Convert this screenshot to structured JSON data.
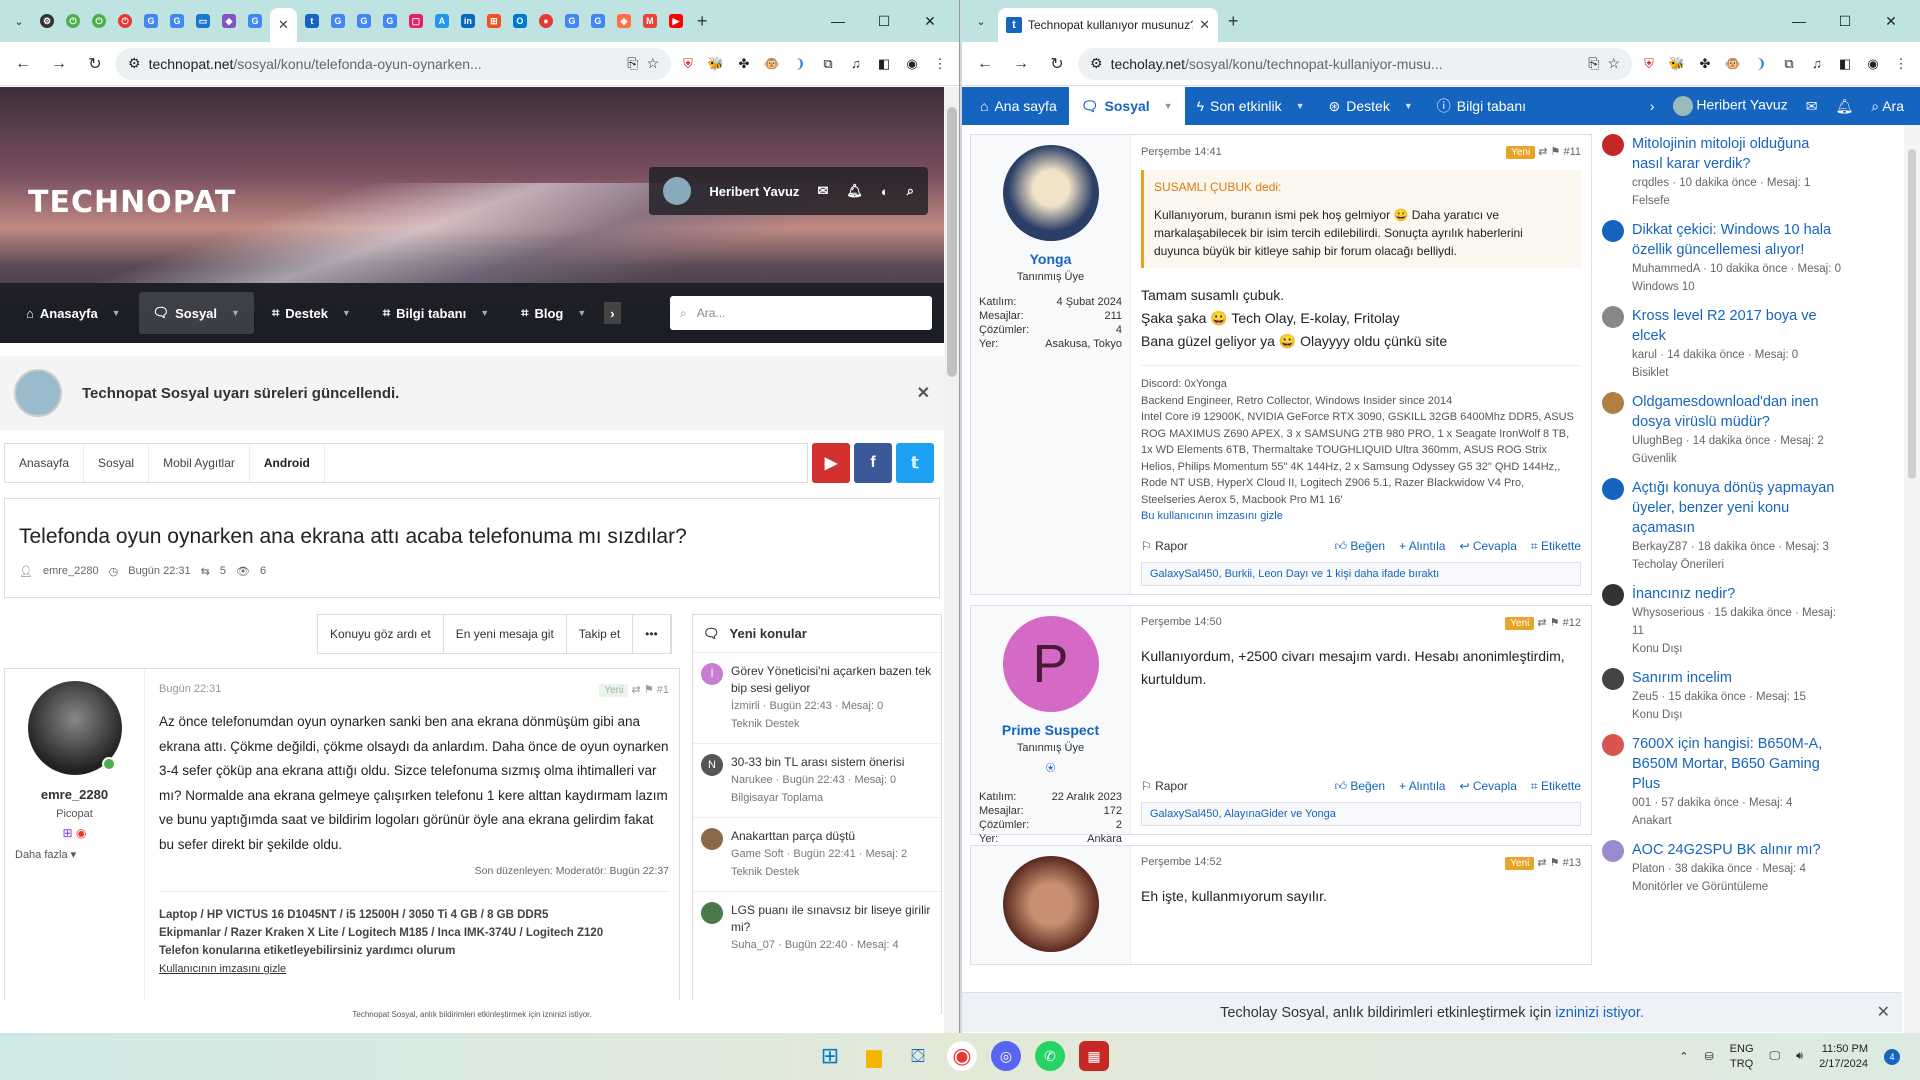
{
  "left_window": {
    "tabs_favicons": [
      "settings",
      "google",
      "power",
      "power",
      "opera",
      "google",
      "google",
      "blue",
      "image",
      "google"
    ],
    "active_tab_label": "",
    "url_host": "technopat.net",
    "url_path": "/sosyal/konu/telefonda-oyun-oynarken...",
    "page": {
      "logo": "TECHNOPAT",
      "user_name": "Heribert Yavuz",
      "nav_items": [
        "Anasayfa",
        "Sosyal",
        "Destek",
        "Bilgi tabanı",
        "Blog"
      ],
      "search_placeholder": "Ara...",
      "notice_text": "Technopat Sosyal uyarı süreleri güncellendi.",
      "breadcrumbs": [
        "Anasayfa",
        "Sosyal",
        "Mobil Aygıtlar",
        "Android"
      ],
      "thread_title": "Telefonda oyun oynarken ana ekrana attı acaba telefonuma mı sızdılar?",
      "thread_author": "emre_2280",
      "thread_date": "Bugün 22:31",
      "thread_replies": "5",
      "thread_views": "6",
      "buttons": [
        "Konuyu göz ardı et",
        "En yeni mesaja git",
        "Takip et",
        "•••"
      ],
      "post": {
        "author": "emre_2280",
        "role": "Picopat",
        "more": "Daha fazla",
        "date": "Bugün 22:31",
        "badge": "Yeni",
        "number": "#1",
        "body": "Az önce telefonumdan oyun oynarken sanki ben ana ekrana dönmüşüm gibi ana ekrana attı. Çökme değildi, çökme olsaydı da anlardım. Daha önce de oyun oynarken 3-4 sefer çöküp ana ekrana attığı oldu. Sizce telefonuma sızmış olma ihtimalleri var mı? Normalde ana ekrana gelmeye çalışırken telefonu 1 kere alttan kaydırmam lazım ve bunu yaptığımda saat ve bildirim logoları görünür öyle ana ekrana gelirdim fakat bu sefer direkt bir şekilde oldu.",
        "edited": "Son düzenleyen: Moderatör: Bugün 22:37",
        "signature_l1": "Laptop / HP VICTUS 16 D1045NT / i5 12500H / 3050 Ti 4 GB / 8 GB DDR5",
        "signature_l2": "Ekipmanlar / Razer Kraken X Lite / Logitech M185 / Inca IMK-374U / Logitech Z120",
        "signature_l3": "Telefon konularına etiketleyebilirsiniz yardımcı olurum",
        "hide_sig": "Kullanıcının imzasını gizle"
      },
      "new_topics_title": "Yeni konular",
      "new_topics": [
        {
          "title": "Görev Yöneticisi'ni açarken bazen tek bip sesi geliyor",
          "meta": "İzmirli · Bugün 22:43 · Mesaj: 0",
          "forum": "Teknik Destek",
          "initial": "İ",
          "color": "#c77dd0"
        },
        {
          "title": "30-33 bin TL arası sistem önerisi",
          "meta": "Narukee · Bugün 22:43 · Mesaj: 0",
          "forum": "Bilgisayar Toplama",
          "initial": "N",
          "color": "#555"
        },
        {
          "title": "Anakarttan parça düştü",
          "meta": "Game Soft · Bugün 22:41 · Mesaj: 2",
          "forum": "Teknik Destek",
          "initial": "",
          "color": "#8a6a4a"
        },
        {
          "title": "LGS puanı ile sınavsız bir liseye girilir mi?",
          "meta": "Suha_07 · Bugün 22:40 · Mesaj: 4",
          "forum": "",
          "initial": "",
          "color": "#4a7a4a"
        }
      ],
      "bottom_notice": "Technopat Sosyal, anlık bildirimleri etkinleştirmek için izninizi istiyor."
    }
  },
  "right_window": {
    "active_tab_label": "Technopat kullanıyor musunuz?",
    "url_host": "techolay.net",
    "url_path": "/sosyal/konu/technopat-kullaniyor-musu...",
    "nav_items": [
      "Ana sayfa",
      "Sosyal",
      "Son etkinlik",
      "Destek",
      "Bilgi tabanı"
    ],
    "user_name": "Heribert Yavuz",
    "search_label": "Ara",
    "posts": [
      {
        "author": "Yonga",
        "role": "Tanınmış Üye",
        "stats": [
          [
            "Katılım:",
            "4 Şubat 2024"
          ],
          [
            "Mesajlar:",
            "211"
          ],
          [
            "Çözümler:",
            "4"
          ],
          [
            "Yer:",
            "Asakusa, Tokyo"
          ]
        ],
        "date": "Perşembe 14:41",
        "badge": "Yeni",
        "number": "#11",
        "quote_author": "SUSAMLI ÇUBUK dedi:",
        "quote": "Kullanıyorum, buranın ismi pek hoş gelmiyor 😀 Daha yaratıcı ve markalaşabilecek bir isim tercih edilebilirdi. Sonuçta ayrılık haberlerini duyunca büyük bir kitleye sahip bir forum olacağı belliydi.",
        "body_l1": "Tamam susamlı çubuk.",
        "body_l2": "Şaka şaka 😀 Tech Olay, E-kolay, Fritolay",
        "body_l3": "Bana güzel geliyor ya 😀 Olayyyy oldu çünkü site",
        "signature": "Discord: 0xYonga\nBackend Engineer, Retro Collector, Windows Insider since 2014\nIntel Core i9 12900K, NVIDIA GeForce RTX 3090, GSKILL 32GB 6400Mhz DDR5, ASUS ROG MAXIMUS Z690 APEX, 3 x SAMSUNG 2TB 980 PRO, 1 x Seagate IronWolf 8 TB, 1x WD Elements 6TB, Thermaltake TOUGHLIQUID Ultra 360mm, ASUS ROG Strix Helios, Philips Momentum 55\" 4K 144Hz, 2 x Samsung Odyssey G5 32\" QHD 144Hz,, Rode NT USB, HyperX Cloud II, Logitech Z906 5.1, Razer Blackwidow V4 Pro, Steelseries Aerox 5, Macbook Pro M1 16'",
        "hide_sig": "Bu kullanıcının imzasını gizle",
        "reactions": "GalaxySal450, Burkii, Leon Dayı ve 1 kişi daha ifade bıraktı"
      },
      {
        "author": "Prime Suspect",
        "role": "Tanınmış Üye",
        "initial": "P",
        "stats": [
          [
            "Katılım:",
            "22 Aralık 2023"
          ],
          [
            "Mesajlar:",
            "172"
          ],
          [
            "Çözümler:",
            "2"
          ],
          [
            "Yer:",
            "Ankara"
          ]
        ],
        "date": "Perşembe 14:50",
        "badge": "Yeni",
        "number": "#12",
        "body": "Kullanıyordum, +2500 civarı mesajım vardı. Hesabı anonimleştirdim, kurtuldum.",
        "reactions": "GalaxySal450, AlayınaGider ve Yonga"
      },
      {
        "date": "Perşembe 14:52",
        "badge": "Yeni",
        "number": "#13",
        "body": "Eh işte, kullanmıyorum sayılır."
      }
    ],
    "actions": [
      "Rapor",
      "Beğen",
      "Alıntıla",
      "Cevapla",
      "Etikette"
    ],
    "sidebar": [
      {
        "title": "Mitolojinin mitoloji olduğuna nasıl karar verdik?",
        "meta": "crqdles · 10 dakika önce · Mesaj: 1",
        "forum": "Felsefe",
        "color": "#c62828"
      },
      {
        "title": "Dikkat çekici: Windows 10 hala özellik güncellemesi alıyor!",
        "meta": "MuhammedA · 10 dakika önce · Mesaj: 0",
        "forum": "Windows 10",
        "color": "#1565c0"
      },
      {
        "title": "Kross level R2 2017 boya ve elcek",
        "meta": "karul · 14 dakika önce · Mesaj: 0",
        "forum": "Bisiklet",
        "color": "#888"
      },
      {
        "title": "Oldgamesdownload'dan inen dosya virüslü müdür?",
        "meta": "UlughBeg · 14 dakika önce · Mesaj: 2",
        "forum": "Güvenlik",
        "color": "#b08040"
      },
      {
        "title": "Açtığı konuya dönüş yapmayan üyeler, benzer yeni konu açamasın",
        "meta": "BerkayZ87 · 18 dakika önce · Mesaj: 3",
        "forum": "Techolay Önerileri",
        "color": "#1565c0"
      },
      {
        "title": "İnancınız nedir?",
        "meta": "Whysoserious · 15 dakika önce · Mesaj: 11",
        "forum": "Konu Dışı",
        "color": "#333"
      },
      {
        "title": "Sanırım incelim",
        "meta": "Zeu5 · 15 dakika önce · Mesaj: 15",
        "forum": "Konu Dışı",
        "color": "#444"
      },
      {
        "title": "7600X için hangisi: B650M-A, B650M Mortar, B650 Gaming Plus",
        "meta": "001 · 57 dakika önce · Mesaj: 4",
        "forum": "Anakart",
        "color": "#d9534f"
      },
      {
        "title": "AOC 24G2SPU BK alınır mı?",
        "meta": "Platon · 38 dakika önce · Mesaj: 4",
        "forum": "Monitörler ve Görüntüleme",
        "color": "#9c8ad0"
      }
    ],
    "bottom_notice_prefix": "Techolay Sosyal, anlık bildirimleri etkinleştirmek için",
    "bottom_notice_link": "izninizi istiyor."
  },
  "taskbar": {
    "lang_top": "ENG",
    "lang_bottom": "TRQ",
    "time": "11:50 PM",
    "date": "2/17/2024",
    "notification_count": "4"
  }
}
